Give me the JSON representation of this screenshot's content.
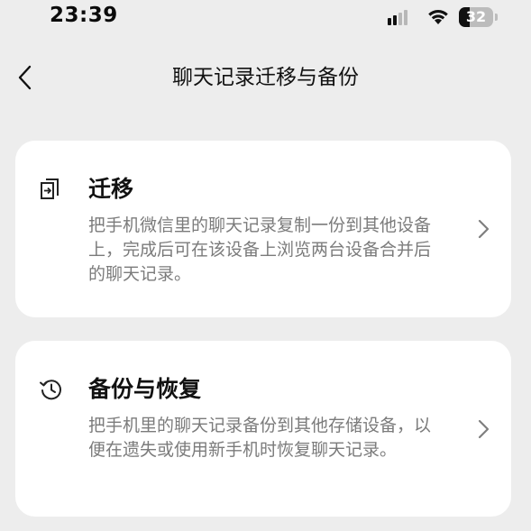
{
  "status_bar": {
    "time": "23:39",
    "battery_percent": "32",
    "battery_level": 0.32,
    "signal_icon": "cellular-signal-icon",
    "wifi_icon": "wifi-icon"
  },
  "nav": {
    "title": "聊天记录迁移与备份",
    "back_icon": "chevron-left-icon"
  },
  "cards": [
    {
      "icon": "migrate-icon",
      "title": "迁移",
      "description": "把手机微信里的聊天记录复制一份到其他设备上，完成后可在该设备上浏览两台设备合并后的聊天记录。"
    },
    {
      "icon": "history-icon",
      "title": "备份与恢复",
      "description": "把手机里的聊天记录备份到其他存储设备，以便在遗失或使用新手机时恢复聊天记录。"
    }
  ],
  "colors": {
    "background": "#ededed",
    "card": "#ffffff",
    "title_text": "#111111",
    "description_text": "#7b7b7b",
    "chevron": "#7f7f7f"
  }
}
